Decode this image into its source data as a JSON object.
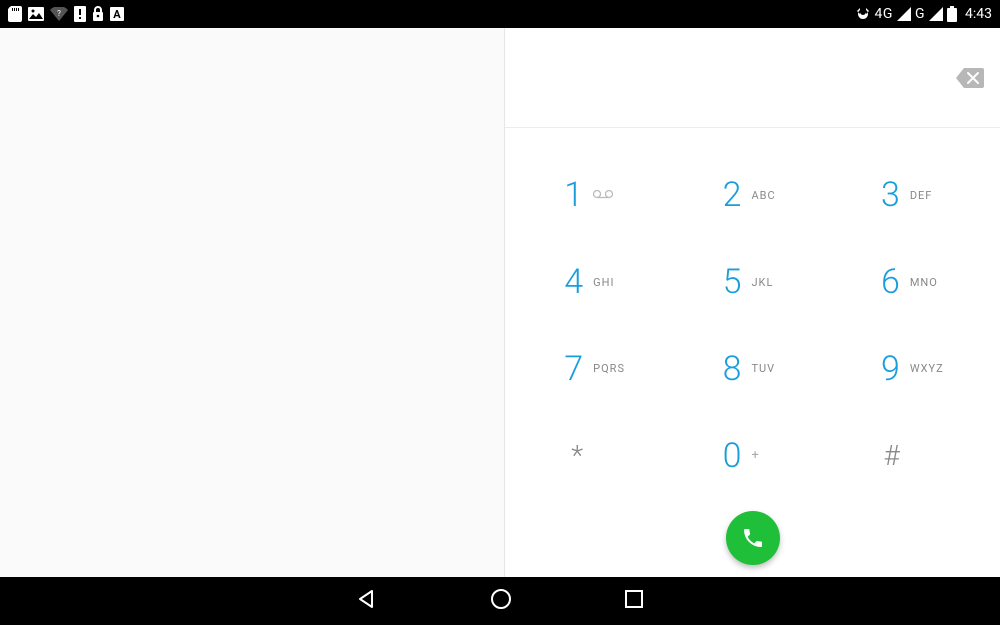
{
  "status_bar": {
    "time": "4:43",
    "net1": "4G",
    "net2": "G"
  },
  "dialer": {
    "input": "",
    "keys": [
      {
        "digit": "1",
        "sub": "voicemail"
      },
      {
        "digit": "2",
        "sub": "ABC"
      },
      {
        "digit": "3",
        "sub": "DEF"
      },
      {
        "digit": "4",
        "sub": "GHI"
      },
      {
        "digit": "5",
        "sub": "JKL"
      },
      {
        "digit": "6",
        "sub": "MNO"
      },
      {
        "digit": "7",
        "sub": "PQRS"
      },
      {
        "digit": "8",
        "sub": "TUV"
      },
      {
        "digit": "9",
        "sub": "WXYZ"
      },
      {
        "digit": "*",
        "sub": ""
      },
      {
        "digit": "0",
        "sub": "+"
      },
      {
        "digit": "#",
        "sub": ""
      }
    ]
  }
}
